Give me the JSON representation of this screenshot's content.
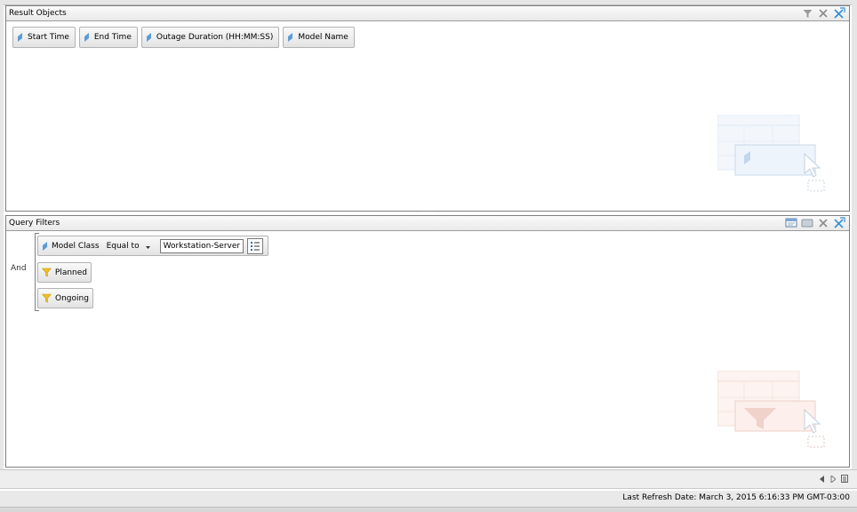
{
  "result_panel": {
    "title": "Result Objects",
    "objects": [
      {
        "label": "Start Time"
      },
      {
        "label": "End Time"
      },
      {
        "label": "Outage Duration (HH:MM:SS)"
      },
      {
        "label": "Model Name"
      }
    ],
    "header_icons": [
      "filter-icon",
      "close-icon",
      "clear-all-icon"
    ]
  },
  "filter_panel": {
    "title": "Query Filters",
    "logic_operator": "And",
    "filters": [
      {
        "object": "Model Class",
        "operator": "Equal to",
        "value": "Workstation-Server"
      },
      {
        "object": "Planned"
      },
      {
        "object": "Ongoing"
      }
    ],
    "header_icons": [
      "add-filter-icon",
      "subquery-icon",
      "close-icon",
      "clear-all-icon"
    ]
  },
  "nav": {
    "icons": [
      "prev-icon",
      "next-icon",
      "menu-icon"
    ]
  },
  "status": {
    "last_refresh": "Last Refresh Date: March 3, 2015 6:16:33 PM GMT-03:00"
  },
  "colors": {
    "dimension_icon": "#5b9bd5",
    "filter_icon": "#f0c020",
    "accent": "#2f8fd8"
  }
}
